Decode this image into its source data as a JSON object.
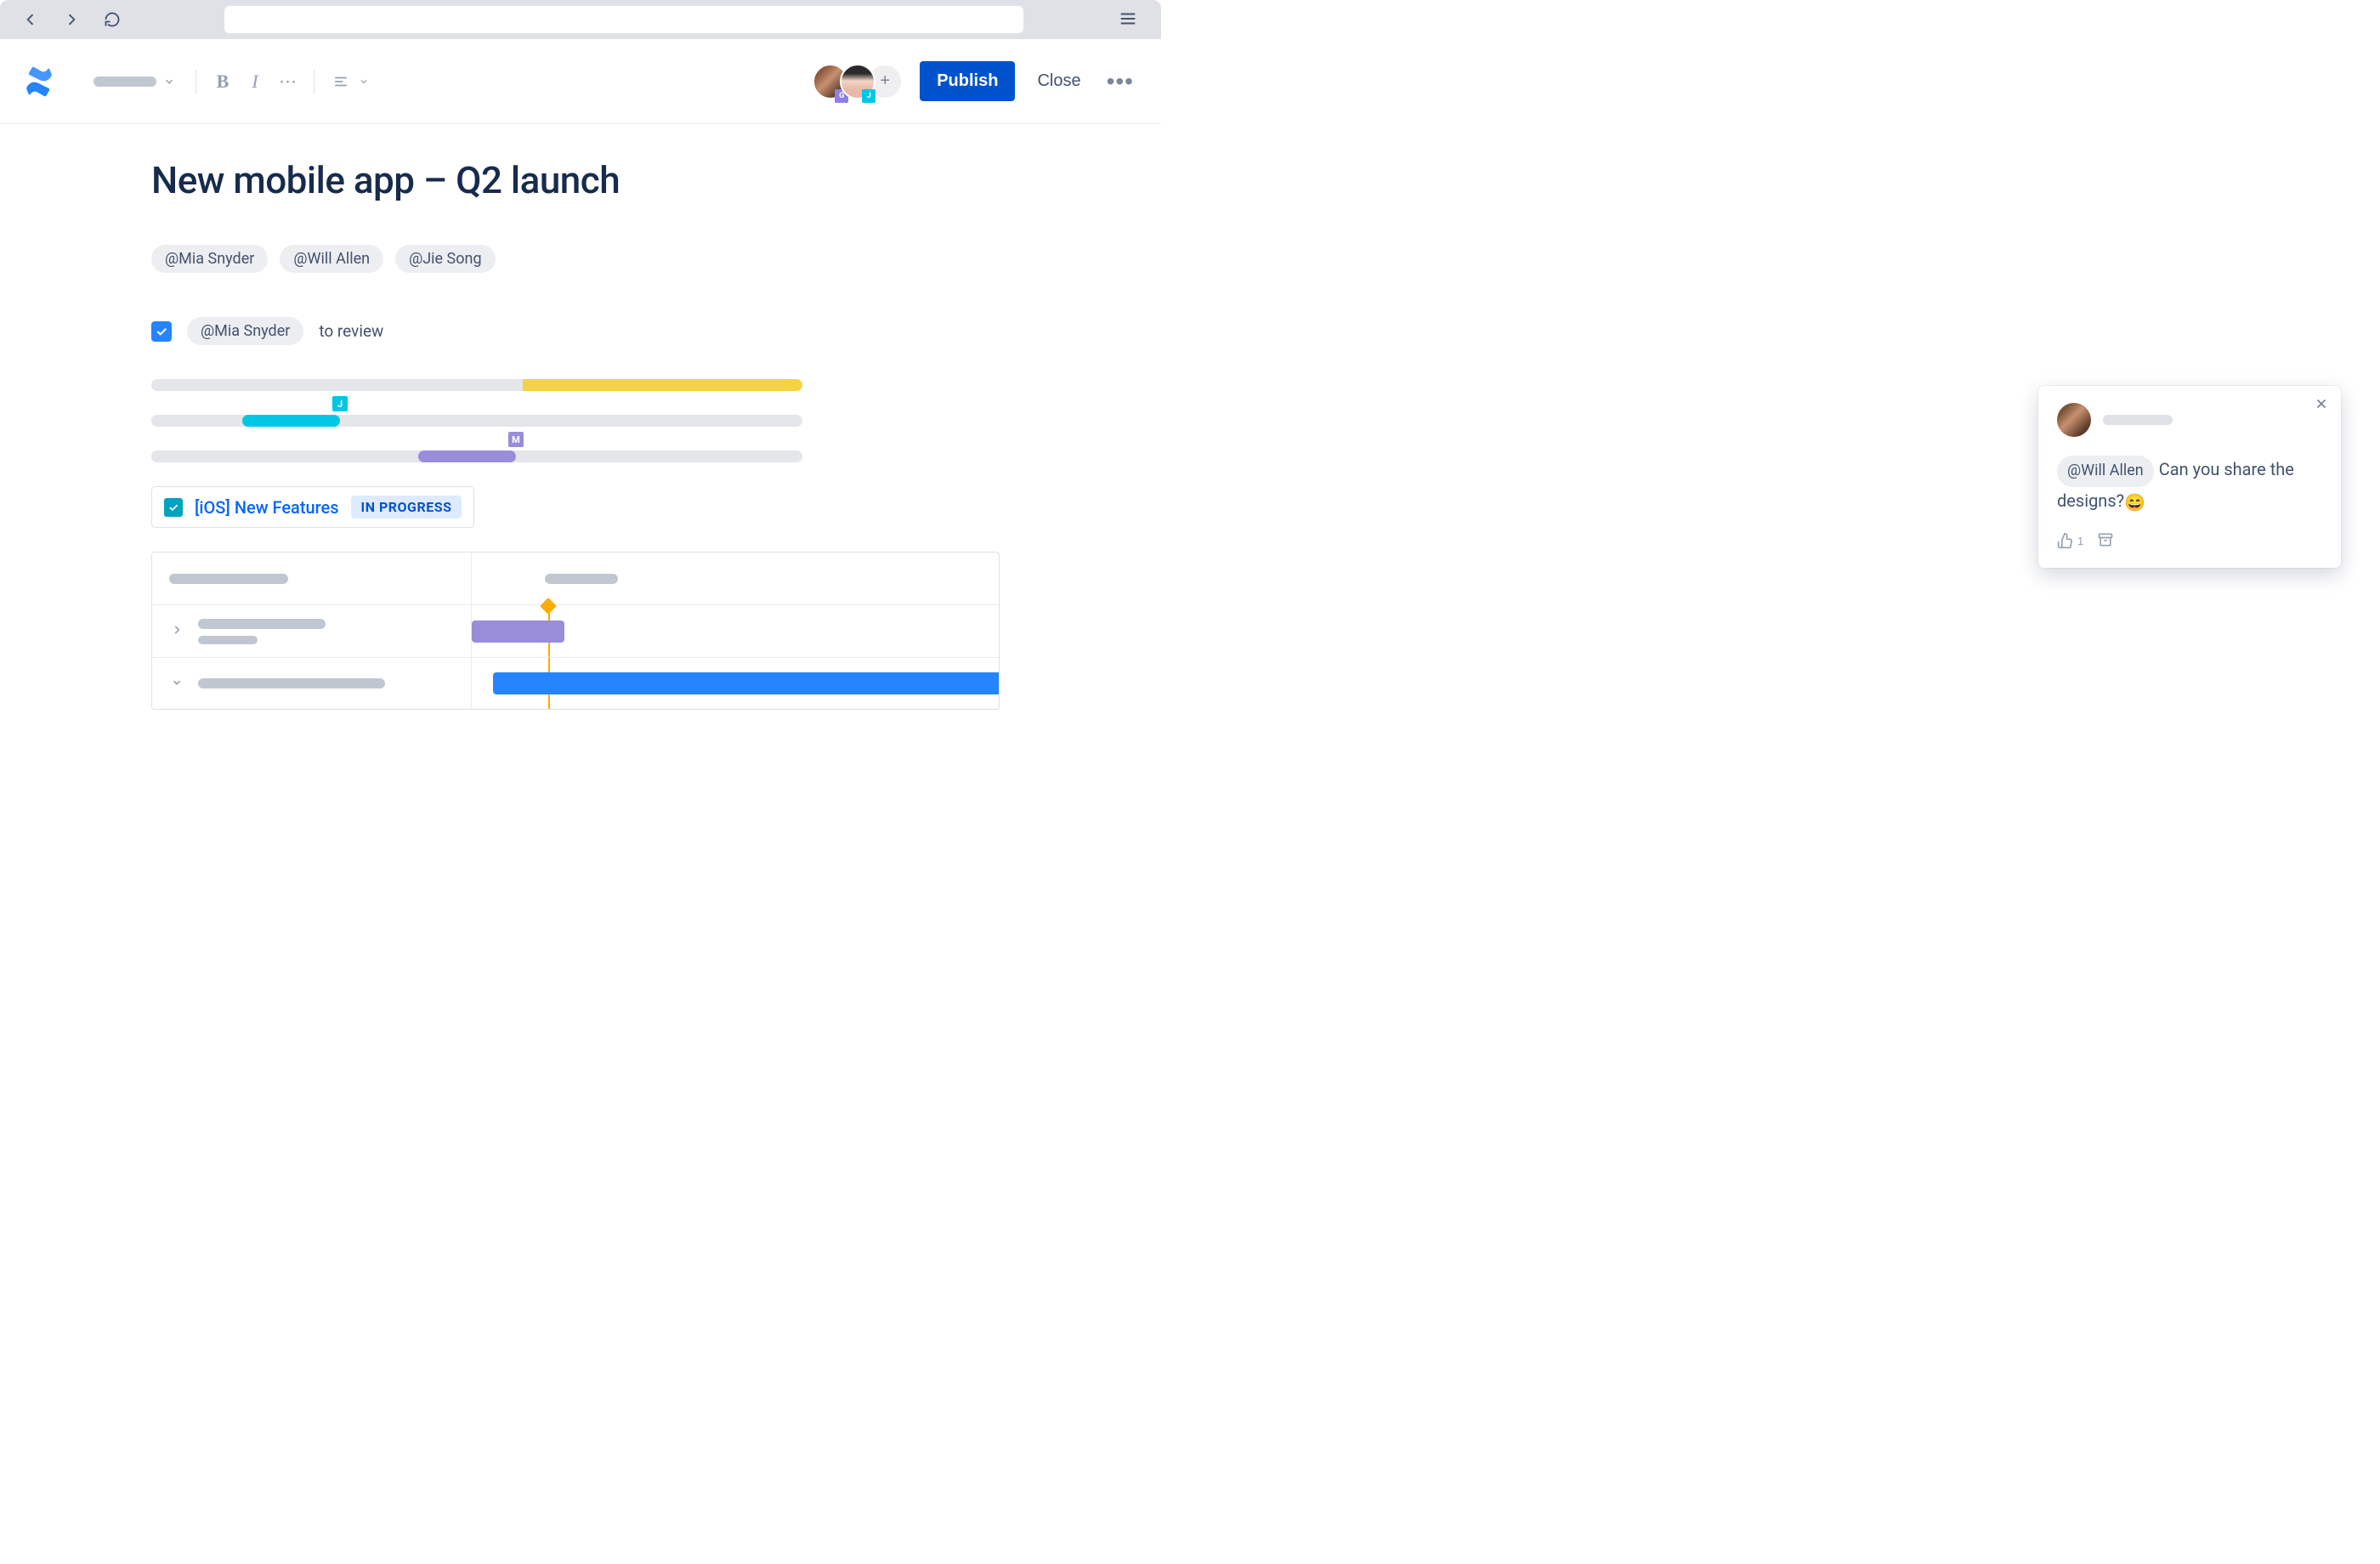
{
  "toolbar": {
    "publish_label": "Publish",
    "close_label": "Close",
    "bold_label": "B",
    "italic_label": "I",
    "more_label": "···",
    "avatar_badges": {
      "first": "G",
      "second": "J"
    },
    "add_avatar_label": "+"
  },
  "page": {
    "title": "New mobile app – Q2 launch",
    "mentions": [
      "@Mia Snyder",
      "@Will Allen",
      "@Jie Song"
    ],
    "task": {
      "checked": true,
      "assignee": "@Mia Snyder",
      "text": "to review"
    },
    "progress_bars": [
      {
        "color": "yellow",
        "start_pct": 57,
        "end_pct": 100,
        "marker": null
      },
      {
        "color": "cyan",
        "start_pct": 14,
        "end_pct": 29,
        "marker": "J"
      },
      {
        "color": "purple",
        "start_pct": 41,
        "end_pct": 56,
        "marker": "M"
      }
    ],
    "jira_card": {
      "title": "[iOS] New Features",
      "status": "IN PROGRESS"
    },
    "gantt": {
      "today_position_pct": 14.5,
      "rows": [
        {
          "type": "header"
        },
        {
          "type": "task",
          "expanded": false,
          "bar": {
            "color": "purple",
            "start_pct": 0,
            "width_pct": 17.5
          }
        },
        {
          "type": "task",
          "expanded": true,
          "bar": {
            "color": "blue",
            "start_pct": 4,
            "width_pct": 96
          }
        }
      ]
    }
  },
  "comment": {
    "mention": "@Will Allen",
    "text": "Can you share the designs?",
    "emoji": "😄",
    "like_count": "1"
  }
}
